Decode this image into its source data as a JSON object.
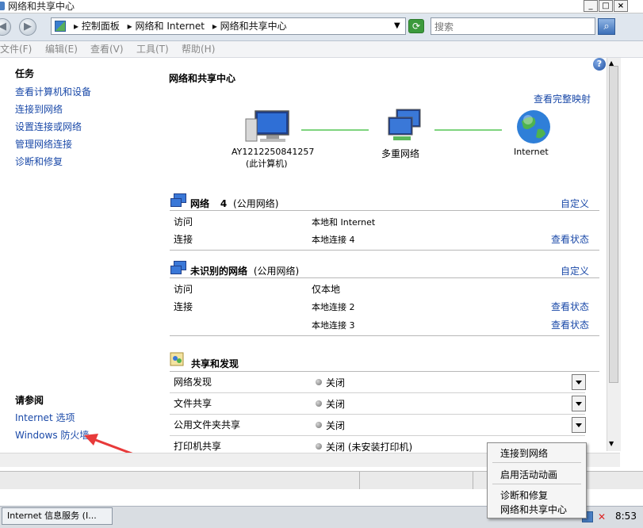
{
  "window": {
    "title": "网络和共享中心",
    "minimize": "_",
    "maximize": "□",
    "close": "×"
  },
  "address": {
    "crumb1": "▸ 控制面板",
    "crumb2": "▸ 网络和 Internet",
    "crumb3": "▸ 网络和共享中心",
    "search_placeholder": "搜索"
  },
  "menu": [
    "文件(F)",
    "编辑(E)",
    "查看(V)",
    "工具(T)",
    "帮助(H)"
  ],
  "left": {
    "tasks_heading": "任务",
    "tasks": [
      "查看计算机和设备",
      "连接到网络",
      "设置连接或网络",
      "管理网络连接",
      "诊断和修复"
    ],
    "see_also_heading": "请参阅",
    "see_also": [
      "Internet 选项",
      "Windows 防火墙"
    ]
  },
  "main": {
    "title": "网络和共享中心",
    "view_full_map": "查看完整映射",
    "map": {
      "computer_name": "AY1212250841257",
      "computer_sub": "(此计算机)",
      "multi_network": "多重网络",
      "internet": "Internet"
    },
    "network1": {
      "name": "网络",
      "number": "4",
      "type": "(公用网络)",
      "customize": "自定义",
      "access_label": "访问",
      "access_value": "本地和 Internet",
      "conn_label": "连接",
      "conn_value": "本地连接 4",
      "view_status": "查看状态"
    },
    "network2": {
      "name": "未识别的网络",
      "type": "(公用网络)",
      "customize": "自定义",
      "access_label": "访问",
      "access_value": "仅本地",
      "conn_label": "连接",
      "conn_value1": "本地连接 2",
      "conn_value2": "本地连接 3",
      "view_status1": "查看状态",
      "view_status2": "查看状态"
    },
    "sharing": {
      "title": "共享和发现",
      "rows": [
        {
          "label": "网络发现",
          "value": "关闭"
        },
        {
          "label": "文件共享",
          "value": "关闭"
        },
        {
          "label": "公用文件夹共享",
          "value": "关闭"
        },
        {
          "label": "打印机共享",
          "value": "关闭 (未安装打印机)"
        }
      ]
    }
  },
  "taskbar": {
    "task": "Internet 信息服务 (I...",
    "clock": "8:53"
  },
  "context_menu": [
    "连接到网络",
    "启用活动动画",
    "诊断和修复",
    "网络和共享中心"
  ],
  "colors": {
    "link": "#1a49a8",
    "arrow": "#e83a3a",
    "line": "#7ed47e"
  }
}
